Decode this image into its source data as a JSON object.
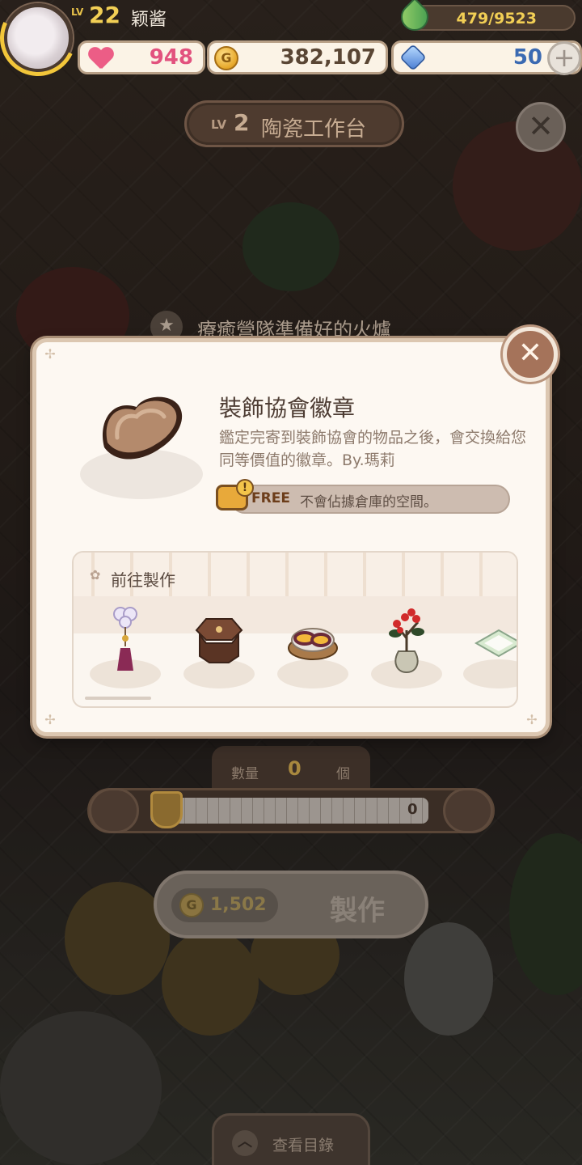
{
  "player": {
    "level_prefix": "LV",
    "level": "22",
    "name": "颖酱",
    "exp_text": "479/9523",
    "exp_fraction": 0.05
  },
  "resources": {
    "hearts": "948",
    "gold": "382,107",
    "gold_coin_glyph": "G",
    "gems": "50",
    "add_glyph": "+"
  },
  "workbench": {
    "level_prefix": "LV",
    "level": "2",
    "name": "陶瓷工作台",
    "close_glyph": "✕"
  },
  "quest": {
    "star_glyph": "★",
    "text": "療癒營隊準備好的火爐"
  },
  "item_dialog": {
    "close_glyph": "✕",
    "title": "裝飾協會徽章",
    "description": "鑑定完寄到裝飾協會的物品之後，會交換給您同等價值的徽章。By.瑪莉",
    "free_badge": "FREE",
    "free_badge_alert": "!",
    "free_text": "不會佔據倉庫的空間。",
    "craft_section": {
      "flower_glyph": "✿",
      "title": "前往製作",
      "items": [
        {
          "icon": "tassel-ornament-icon"
        },
        {
          "icon": "wooden-table-icon"
        },
        {
          "icon": "roasted-sweet-potato-icon"
        },
        {
          "icon": "red-berry-vase-icon"
        },
        {
          "icon": "cushion-icon"
        }
      ]
    }
  },
  "quantity": {
    "label": "數量",
    "value": "0",
    "unit": "個",
    "slider_value": "0"
  },
  "make_button": {
    "coin_glyph": "G",
    "cost": "1,502",
    "label": "製作"
  },
  "bottom_tab": {
    "icon_glyph": "︿",
    "label": "查看目錄"
  },
  "colors": {
    "dialog_bg": "#fdf8f2",
    "dialog_border": "#dcc7b1",
    "heart": "#e2527e",
    "gold_text": "#f2cf55",
    "gem_text": "#3b6ab2"
  }
}
